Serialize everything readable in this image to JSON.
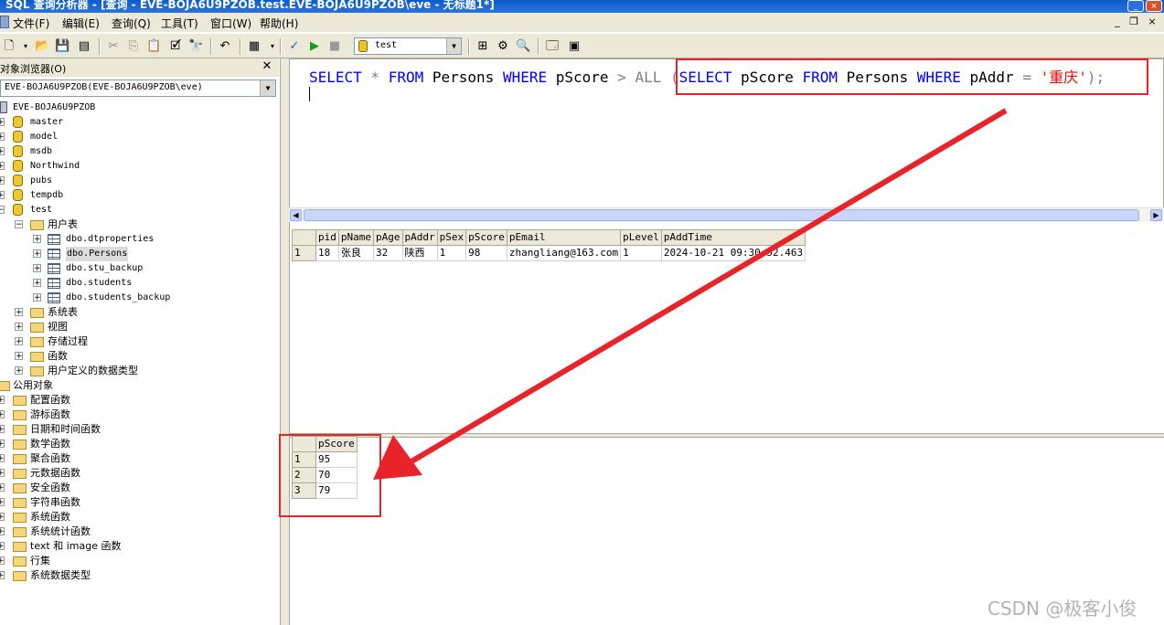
{
  "window": {
    "title": "SQL 查询分析器 - [查询 - EVE-BOJA6U9PZOB.test.EVE-BOJA6U9PZOB\\eve - 无标题1*]"
  },
  "menu": [
    "文件(F)",
    "编辑(E)",
    "查询(Q)",
    "工具(T)",
    "窗口(W)",
    "帮助(H)"
  ],
  "toolbar": {
    "database": "test",
    "icons": [
      "new-query-icon",
      "open-icon",
      "save-icon",
      "load-script-icon",
      "cut-icon",
      "copy-icon",
      "paste-icon",
      "clear-icon",
      "find-icon",
      "undo-icon",
      "grid-mode-icon",
      "parse-icon",
      "execute-icon",
      "stop-icon",
      "db-icon",
      "execution-plan-icon",
      "trace-icon",
      "index-tuning-icon",
      "object-browser-icon",
      "results-pane-icon"
    ]
  },
  "object_browser": {
    "title": "对象浏览器(O)",
    "server_combo": "EVE-BOJA6U9PZOB(EVE-BOJA6U9PZOB\\eve)",
    "server": "EVE-BOJA6U9PZOB",
    "databases": [
      "master",
      "model",
      "msdb",
      "Northwind",
      "pubs",
      "tempdb",
      "test"
    ],
    "user_tables_folder": "用户表",
    "tables": [
      "dbo.dtproperties",
      "dbo.Persons",
      "dbo.stu_backup",
      "dbo.students",
      "dbo.students_backup"
    ],
    "test_folders": [
      "系统表",
      "视图",
      "存储过程",
      "函数",
      "用户定义的数据类型"
    ],
    "public_objects": "公用对象",
    "function_folders": [
      "配置函数",
      "游标函数",
      "日期和时间函数",
      "数学函数",
      "聚合函数",
      "元数据函数",
      "安全函数",
      "字符串函数",
      "系统函数",
      "系统统计函数",
      "text 和 image 函数",
      "行集",
      "系统数据类型"
    ]
  },
  "query": {
    "part1": "SELECT",
    "part2": " * ",
    "part3": "FROM",
    "part4": " Persons ",
    "part5": "WHERE",
    "part6": " pScore ",
    "part7": ">",
    "part8": " ALL ",
    "part9": "(",
    "part10": "SELECT",
    "part11": " pScore ",
    "part12": "FROM",
    "part13": " Persons ",
    "part14": "WHERE",
    "part15": " pAddr ",
    "part16": "=",
    "part17": " ",
    "part18": "'重庆'",
    "part19": ");"
  },
  "result1": {
    "columns": [
      "pid",
      "pName",
      "pAge",
      "pAddr",
      "pSex",
      "pScore",
      "pEmail",
      "pLevel",
      "pAddTime"
    ],
    "rows": [
      {
        "rn": "1",
        "cells": [
          "18",
          "张良",
          "32",
          "陕西",
          "1",
          "98",
          "zhangliang@163.com",
          "1",
          "2024-10-21 09:30:52.463"
        ]
      }
    ]
  },
  "result2": {
    "columns": [
      "pScore"
    ],
    "rows": [
      {
        "rn": "1",
        "cells": [
          "95"
        ]
      },
      {
        "rn": "2",
        "cells": [
          "70"
        ]
      },
      {
        "rn": "3",
        "cells": [
          "79"
        ]
      }
    ]
  },
  "annotation": {
    "color": "#e8242a"
  },
  "watermark": "CSDN @极客小俊"
}
